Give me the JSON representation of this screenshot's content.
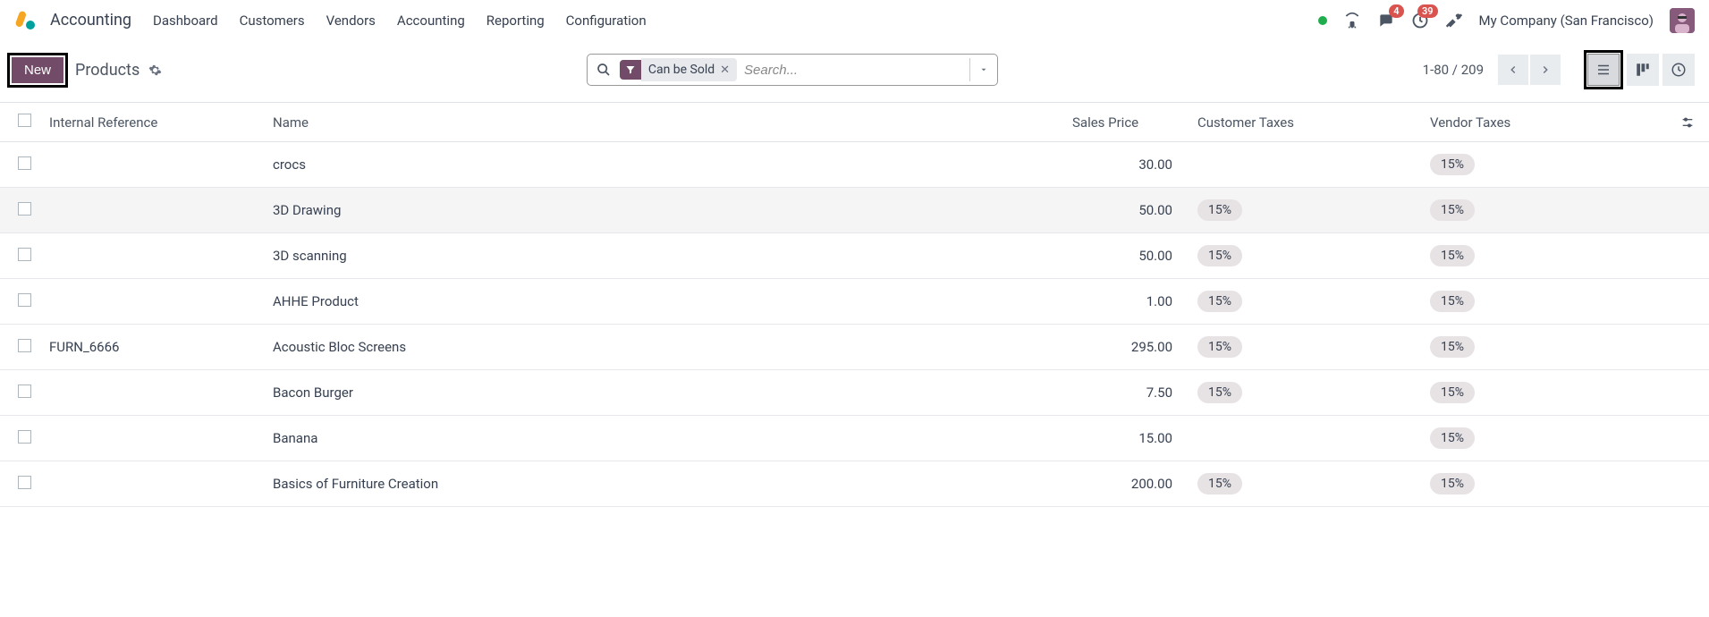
{
  "app_name": "Accounting",
  "nav": [
    "Dashboard",
    "Customers",
    "Vendors",
    "Accounting",
    "Reporting",
    "Configuration"
  ],
  "badges": {
    "messages": "4",
    "activities": "39"
  },
  "company": "My Company (San Francisco)",
  "new_button": "New",
  "breadcrumb": "Products",
  "filter_chip": "Can be Sold",
  "search_placeholder": "Search...",
  "pager": "1-80 / 209",
  "columns": {
    "internal_ref": "Internal Reference",
    "name": "Name",
    "sales_price": "Sales Price",
    "customer_taxes": "Customer Taxes",
    "vendor_taxes": "Vendor Taxes"
  },
  "rows": [
    {
      "ref": "",
      "name": "crocs",
      "price": "30.00",
      "ctax": "",
      "vtax": "15%"
    },
    {
      "ref": "",
      "name": "3D Drawing",
      "price": "50.00",
      "ctax": "15%",
      "vtax": "15%"
    },
    {
      "ref": "",
      "name": "3D scanning",
      "price": "50.00",
      "ctax": "15%",
      "vtax": "15%"
    },
    {
      "ref": "",
      "name": "AHHE Product",
      "price": "1.00",
      "ctax": "15%",
      "vtax": "15%"
    },
    {
      "ref": "FURN_6666",
      "name": "Acoustic Bloc Screens",
      "price": "295.00",
      "ctax": "15%",
      "vtax": "15%"
    },
    {
      "ref": "",
      "name": "Bacon Burger",
      "price": "7.50",
      "ctax": "15%",
      "vtax": "15%"
    },
    {
      "ref": "",
      "name": "Banana",
      "price": "15.00",
      "ctax": "",
      "vtax": "15%"
    },
    {
      "ref": "",
      "name": "Basics of Furniture Creation",
      "price": "200.00",
      "ctax": "15%",
      "vtax": "15%"
    }
  ]
}
